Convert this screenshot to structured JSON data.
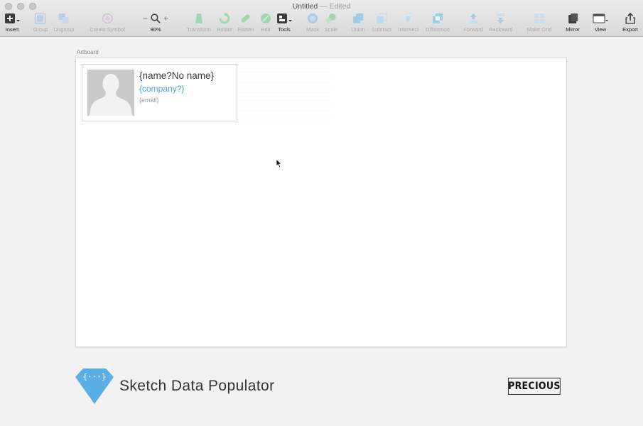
{
  "window": {
    "title": "Untitled",
    "separator": "—",
    "status": "Edited"
  },
  "toolbar": {
    "insert": "Insert",
    "group": "Group",
    "ungroup": "Ungroup",
    "create_symbol": "Create Symbol",
    "zoom_minus": "−",
    "zoom_plus": "+",
    "zoom_level": "90%",
    "transform": "Transform",
    "rotate": "Rotate",
    "flatten": "Flatten",
    "edit": "Edit",
    "tools": "Tools",
    "mask": "Mask",
    "scale": "Scale",
    "union": "Union",
    "subtract": "Subtract",
    "intersect": "Intersect",
    "difference": "Difference",
    "forward": "Forward",
    "backward": "Backward",
    "make_grid": "Make Grid",
    "mirror": "Mirror",
    "view": "View",
    "export": "Export"
  },
  "canvas": {
    "artboard_label": "Artboard",
    "card": {
      "name": "{name?No name}",
      "company": "{company?}",
      "email": "{email}"
    }
  },
  "footer": {
    "brand": "Sketch Data Populator",
    "logo_glyph": "{···}",
    "badge": "PRECIOUS"
  },
  "colors": {
    "accent_blue": "#4aa3df",
    "logo_blue": "#5aaee6",
    "toolbar_bg": "#dddddd",
    "canvas_bg": "#f2f2f2"
  }
}
